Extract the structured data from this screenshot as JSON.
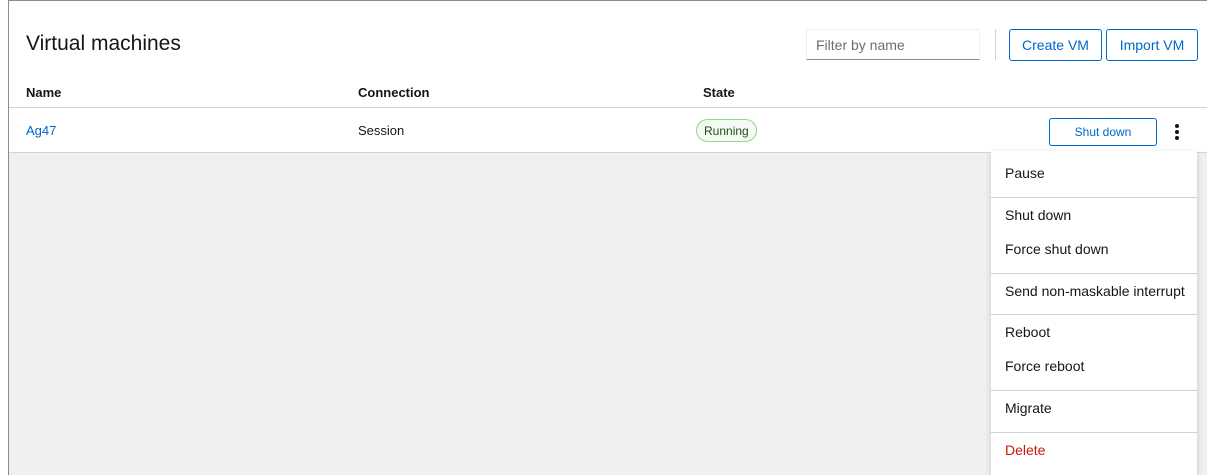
{
  "header": {
    "title": "Virtual machines",
    "filter_placeholder": "Filter by name",
    "create_label": "Create VM",
    "import_label": "Import VM"
  },
  "table": {
    "columns": [
      "Name",
      "Connection",
      "State"
    ],
    "rows": [
      {
        "name": "Ag47",
        "connection": "Session",
        "state": "Running",
        "action": "Shut down"
      }
    ]
  },
  "menu": {
    "items": [
      "Pause",
      "Shut down",
      "Force shut down",
      "Send non-maskable interrupt",
      "Reboot",
      "Force reboot",
      "Migrate",
      "Delete"
    ]
  },
  "colors": {
    "accent": "#0066cc",
    "success_border": "#95d58e",
    "danger": "#c9190b"
  }
}
